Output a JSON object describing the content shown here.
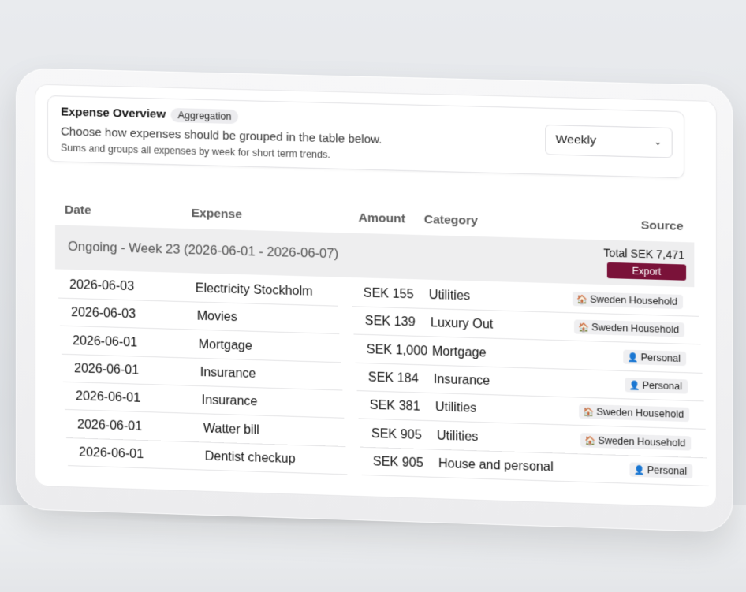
{
  "header": {
    "title": "Expense Overview",
    "badge": "Aggregation",
    "description": "Choose how expenses should be grouped in the table below.",
    "subtext": "Sums and groups all expenses by week for short term trends.",
    "grouping_select": {
      "value": "Weekly"
    }
  },
  "table": {
    "columns": {
      "date": "Date",
      "expense": "Expense",
      "amount": "Amount",
      "category": "Category",
      "source": "Source"
    },
    "group": {
      "label": "Ongoing - Week 23 (2026-06-01 - 2026-06-07)",
      "total": "Total SEK 7,471",
      "export_label": "Export"
    },
    "rows": [
      {
        "date": "2026-06-03",
        "expense": "Electricity Stockholm",
        "amount": "SEK 155",
        "category": "Utilities",
        "source": "Sweden Household",
        "source_icon": "house-icon"
      },
      {
        "date": "2026-06-03",
        "expense": "Movies",
        "amount": "SEK 139",
        "category": "Luxury Out",
        "source": "Sweden Household",
        "source_icon": "house-icon"
      },
      {
        "date": "2026-06-01",
        "expense": "Mortgage",
        "amount": "SEK 1,000",
        "category": "Mortgage",
        "source": "Personal",
        "source_icon": "person-icon"
      },
      {
        "date": "2026-06-01",
        "expense": "Insurance",
        "amount": "SEK 184",
        "category": "Insurance",
        "source": "Personal",
        "source_icon": "person-icon"
      },
      {
        "date": "2026-06-01",
        "expense": "Insurance",
        "amount": "SEK 381",
        "category": "Utilities",
        "source": "Sweden Household",
        "source_icon": "house-icon"
      },
      {
        "date": "2026-06-01",
        "expense": "Watter bill",
        "amount": "SEK 905",
        "category": "Utilities",
        "source": "Sweden Household",
        "source_icon": "house-icon"
      },
      {
        "date": "2026-06-01",
        "expense": "Dentist checkup",
        "amount": "SEK 905",
        "category": "House and personal",
        "source": "Personal",
        "source_icon": "person-icon"
      }
    ]
  },
  "colors": {
    "accent": "#7a1239",
    "group_bg": "#eeeeef"
  }
}
